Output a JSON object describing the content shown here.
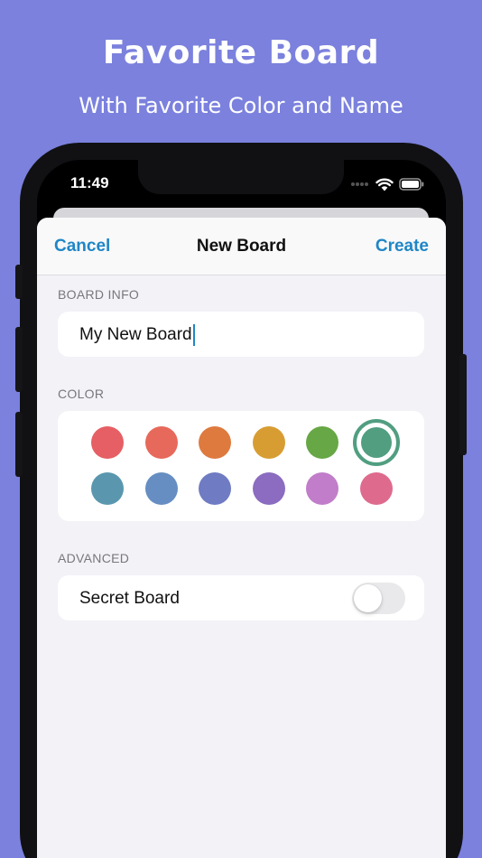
{
  "hero": {
    "title": "Favorite Board",
    "subtitle": "With Favorite Color and Name"
  },
  "status_bar": {
    "time": "11:49",
    "icons": [
      "signal-dots-icon",
      "wifi-icon",
      "battery-icon"
    ]
  },
  "navbar": {
    "cancel_label": "Cancel",
    "title": "New Board",
    "create_label": "Create"
  },
  "board_info": {
    "header": "BOARD INFO",
    "name_value": "My New Board"
  },
  "color": {
    "header": "COLOR",
    "selected_index": 5,
    "swatches": [
      "#e55f64",
      "#e7695b",
      "#de7a3e",
      "#d89d32",
      "#67a745",
      "#519e81",
      "#5a97ae",
      "#668ec2",
      "#6f7bc2",
      "#8b6cc0",
      "#c17dc9",
      "#de6b8e"
    ]
  },
  "advanced": {
    "header": "ADVANCED",
    "secret_label": "Secret Board",
    "secret_on": false
  },
  "colors": {
    "background": "#7b81dd",
    "accent": "#1f86c6"
  }
}
